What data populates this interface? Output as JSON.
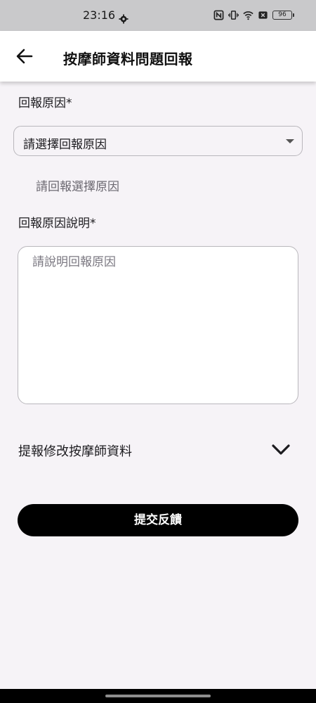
{
  "status_bar": {
    "time": "23:16",
    "battery": "96",
    "icons": [
      "gear-icon",
      "nfc-icon",
      "vibrate-icon",
      "wifi-icon",
      "sim-off-icon",
      "battery-icon"
    ]
  },
  "app_bar": {
    "title": "按摩師資料問題回報",
    "back_icon": "arrow-left-icon"
  },
  "form": {
    "reason_label": "回報原因*",
    "reason_select_value": "請選擇回報原因",
    "reason_helper": "請回報選擇原因",
    "description_label": "回報原因說明*",
    "description_placeholder": "請說明回報原因",
    "description_value": ""
  },
  "expand_section": {
    "label": "提報修改按摩師資料",
    "icon": "chevron-down-icon"
  },
  "submit_button": {
    "label": "提交反饋"
  },
  "colors": {
    "background": "#f6f3f7",
    "primary_button": "#000000",
    "border": "#b9b7bc"
  }
}
